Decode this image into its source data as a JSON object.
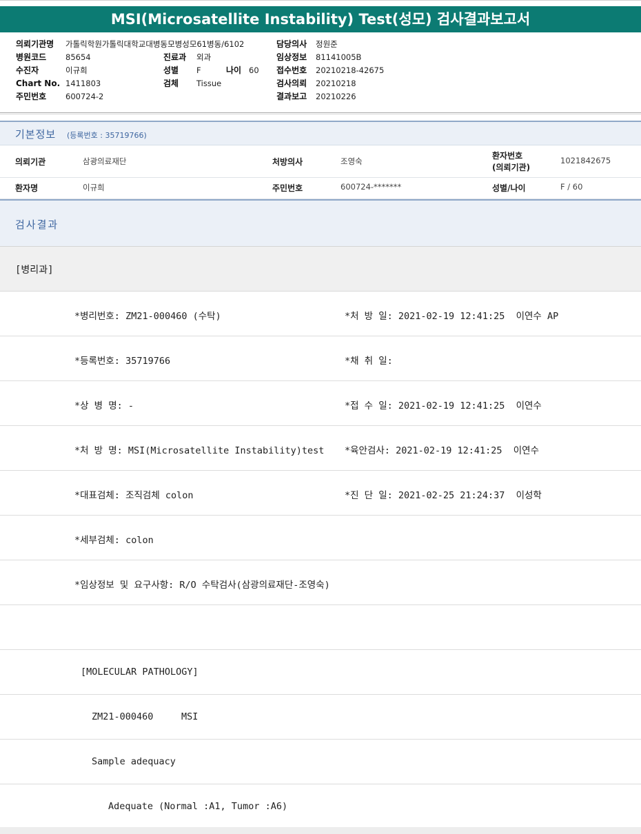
{
  "title": "MSI(Microsatellite Instability) Test(성모) 검사결과보고서",
  "header": {
    "col1": [
      {
        "label": "의뢰기관명",
        "value": "가톨릭학원가톨릭대학교대병동모병성모61병동/6102"
      },
      {
        "label": "병원코드",
        "value": "85654"
      },
      {
        "label": "수진자",
        "value": "이규희"
      },
      {
        "label": "Chart No.",
        "value": "1411803"
      },
      {
        "label": "주민번호",
        "value": "600724-2"
      }
    ],
    "col2": [
      {
        "label": "진료과",
        "value": "외과"
      },
      {
        "label": "성별",
        "value": "F"
      },
      {
        "label": "검체",
        "value": "Tissue"
      }
    ],
    "age": {
      "label": "나이",
      "value": "60"
    },
    "col3": [
      {
        "label": "담당의사",
        "value": "정원준"
      },
      {
        "label": "임상정보",
        "value": "81141005B"
      },
      {
        "label": "접수번호",
        "value": "20210218-42675"
      },
      {
        "label": "검사의뢰",
        "value": "20210218"
      },
      {
        "label": "결과보고",
        "value": "20210226"
      }
    ]
  },
  "basic_info": {
    "title": "기본정보",
    "subtitle": "(등록번호 : 35719766)",
    "row1": {
      "institution_label": "의뢰기관",
      "institution_value": "삼광의료재단",
      "doctor_label": "처방의사",
      "doctor_value": "조영숙",
      "patient_no_label_1": "환자번호",
      "patient_no_label_2": "(의뢰기관)",
      "patient_no_value": "1021842675"
    },
    "row2": {
      "name_label": "환자명",
      "name_value": "이규희",
      "rrn_label": "주민번호",
      "rrn_value": "600724-*******",
      "sexage_label": "성별/나이",
      "sexage_value": "F / 60"
    }
  },
  "result": {
    "title": "검사결과",
    "dept": "[병리과]",
    "rows": [
      {
        "left": "*병리번호: ZM21-000460 (수탁)",
        "right": "*처 방 일: 2021-02-19 12:41:25  이연수 AP"
      },
      {
        "left": "*등록번호: 35719766",
        "right": "*채 취 일:"
      },
      {
        "left": "*상 병 명: -",
        "right": "*접 수 일: 2021-02-19 12:41:25  이연수"
      },
      {
        "left": "*처 방 명: MSI(Microsatellite Instability)test",
        "right": "*육안검사: 2021-02-19 12:41:25  이연수"
      },
      {
        "left": "*대표검체: 조직검체 colon",
        "right": "*진 단 일: 2021-02-25 21:24:37  이성학"
      },
      {
        "left": "*세부검체: colon",
        "right": ""
      },
      {
        "left": "*임상정보 및 요구사항: R/O 수탁검사(삼광의료재단-조영숙)",
        "right": ""
      }
    ],
    "blank": "",
    "molecular_header": "[MOLECULAR PATHOLOGY]",
    "test_line": "ZM21-000460     MSI",
    "adequacy_title": "Sample adequacy",
    "adequacy_value": "Adequate (Normal :A1, Tumor :A6)"
  }
}
